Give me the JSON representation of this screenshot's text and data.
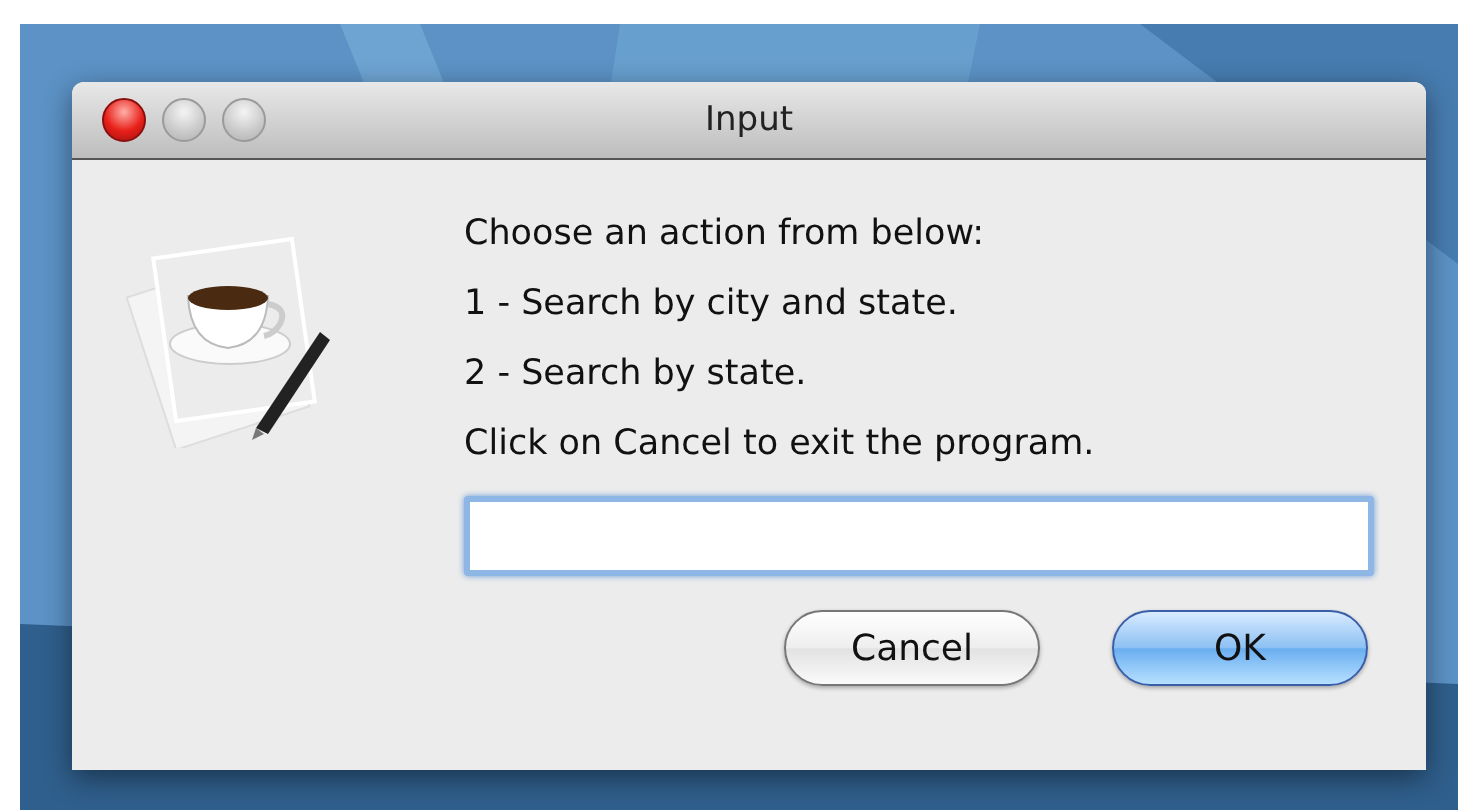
{
  "window": {
    "title": "Input"
  },
  "message_lines": [
    "Choose an action from below:",
    "1 - Search by city and state.",
    "2 - Search by state.",
    "Click on Cancel to exit the program."
  ],
  "input": {
    "focused": true
  },
  "buttons": [
    {
      "label": "Cancel",
      "default": false
    },
    {
      "label": "OK",
      "default": true
    }
  ]
}
